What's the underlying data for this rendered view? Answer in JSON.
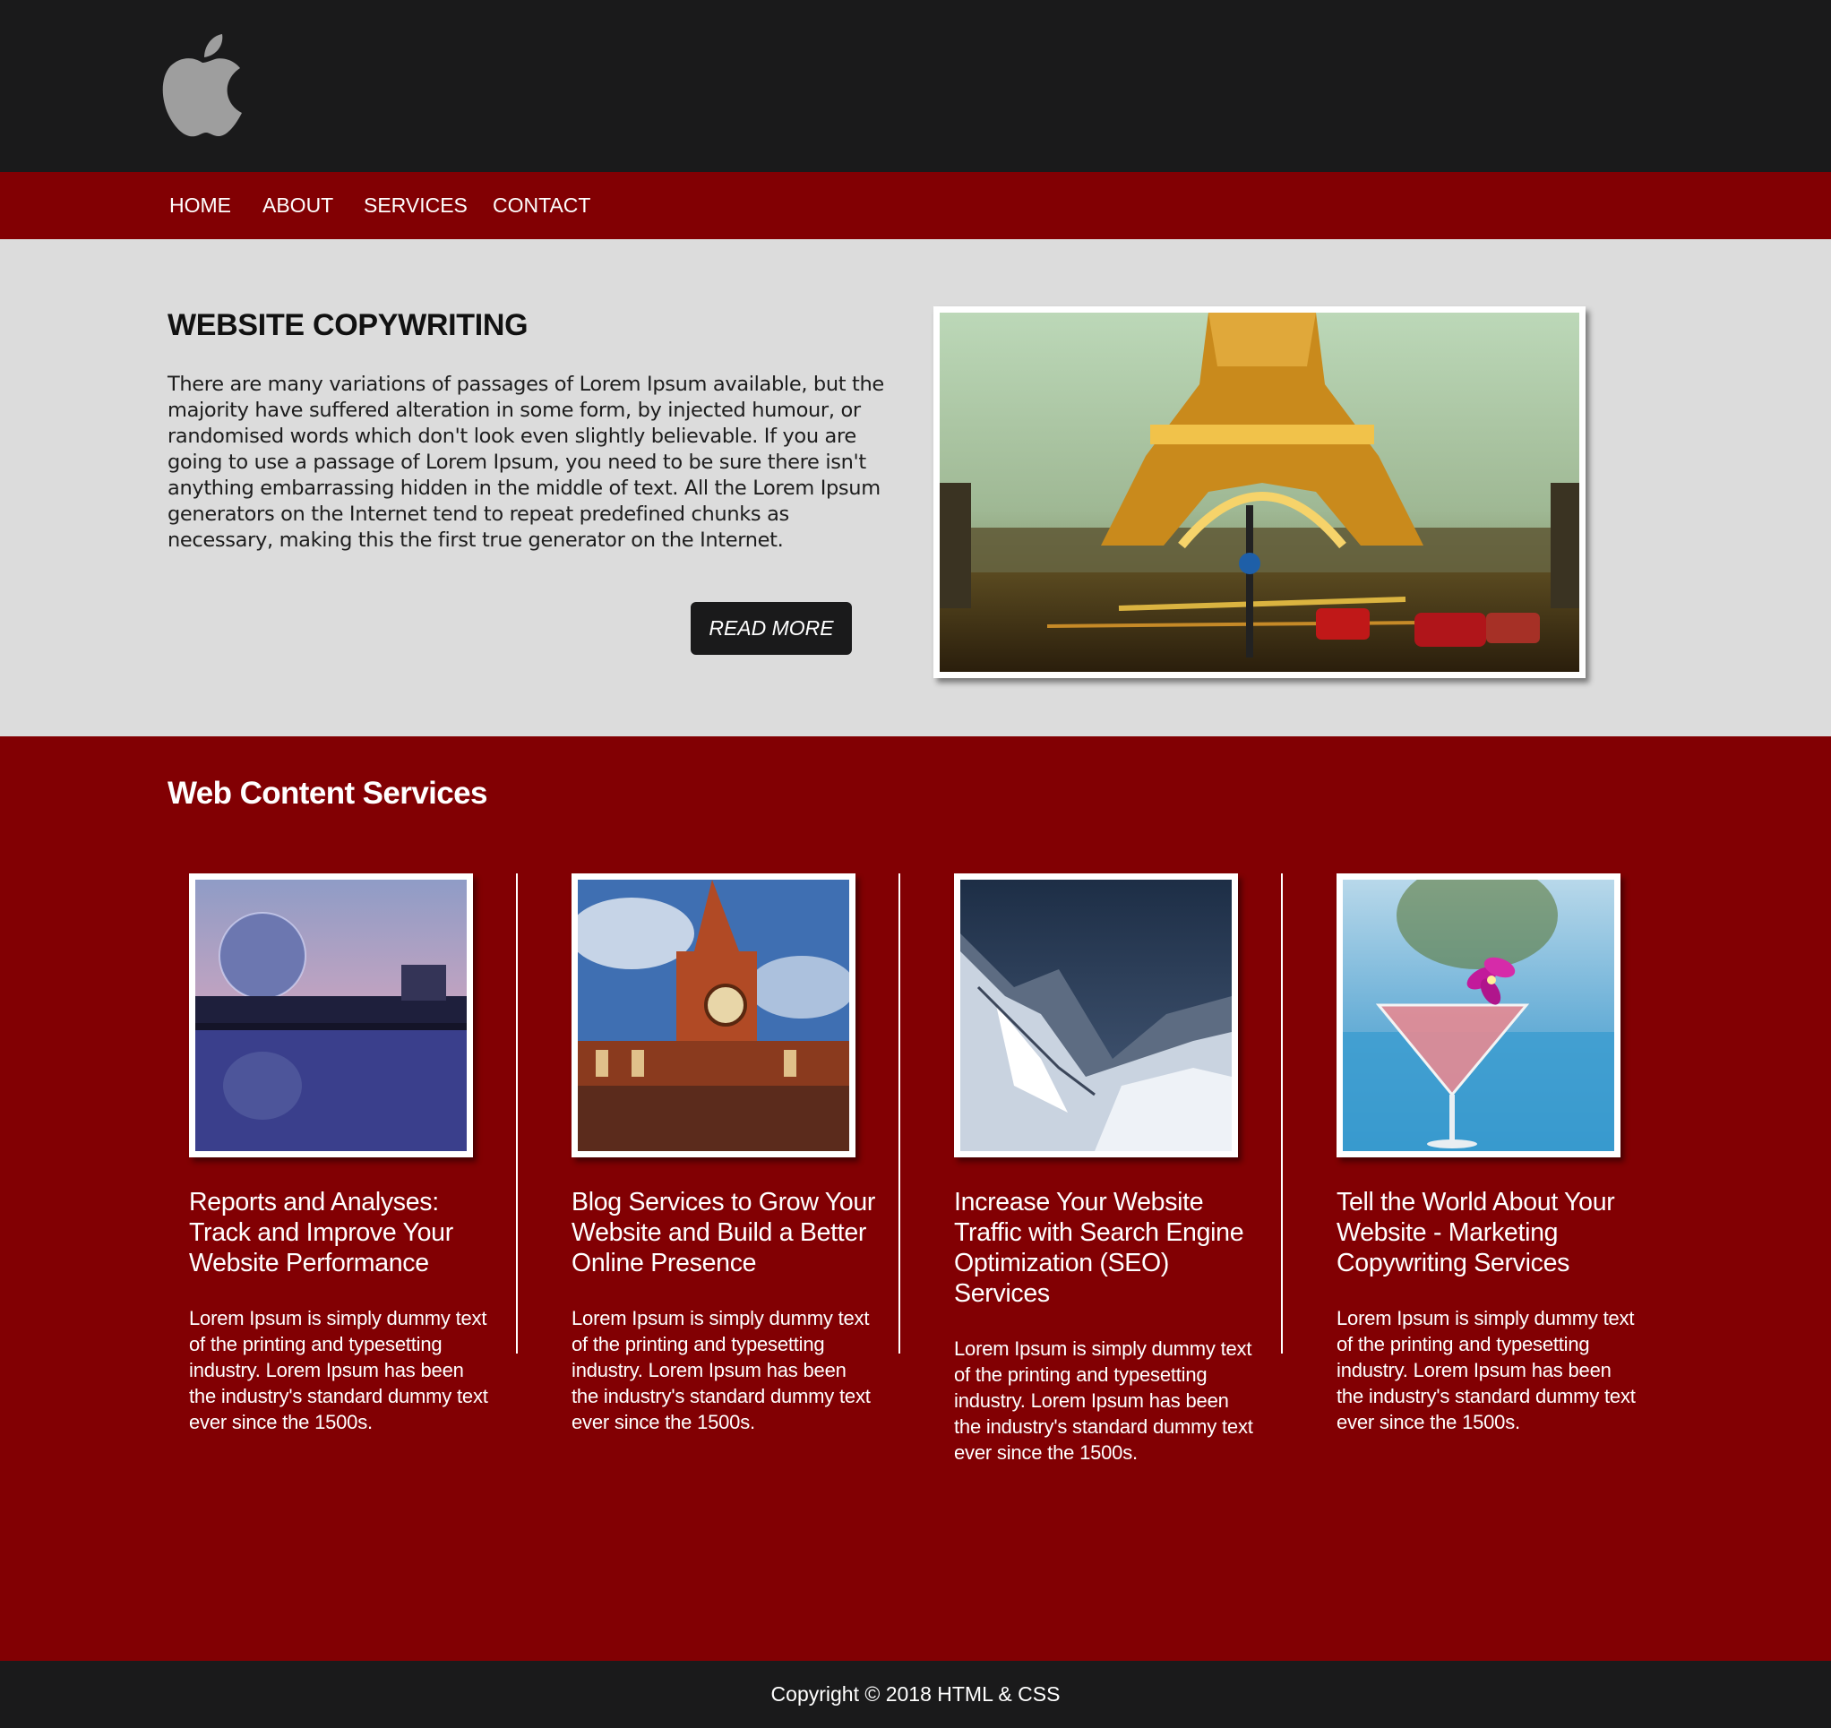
{
  "header": {
    "logo_icon": "apple-logo-icon",
    "nav": [
      {
        "label": "HOME"
      },
      {
        "label": "ABOUT"
      },
      {
        "label": "SERVICES"
      },
      {
        "label": "CONTACT"
      }
    ]
  },
  "hero": {
    "title": "WEBSITE COPYWRITING",
    "body": "There are many variations of passages of Lorem Ipsum available, but the majority have suffered alteration in some form, by injected humour, or randomised words which don't look even slightly believable. If you are going to use a passage of Lorem Ipsum, you need to be sure there isn't anything embarrassing hidden in the middle of text. All the Lorem Ipsum generators on the Internet tend to repeat predefined chunks as necessary, making this the first true generator on the Internet.",
    "button_label": "READ MORE",
    "image": "eiffel-tower-photo"
  },
  "services": {
    "title": "Web Content Services",
    "cards": [
      {
        "image": "science-dome-reflection-photo",
        "title": "Reports and Analyses: Track and Improve Your Website Performance",
        "text": "Lorem Ipsum is simply dummy text of the printing and typesetting industry. Lorem Ipsum has been the industry's standard dummy text ever since the 1500s."
      },
      {
        "image": "gothic-clock-tower-photo",
        "title": "Blog Services to Grow Your Website and Build a Better Online Presence",
        "text": "Lorem Ipsum is simply dummy text of the printing and typesetting industry. Lorem Ipsum has been the industry's standard dummy text ever since the 1500s."
      },
      {
        "image": "snowy-mountains-photo",
        "title": "Increase Your Website Traffic with Search Engine Optimization (SEO) Services",
        "text": "Lorem Ipsum is simply dummy text of the printing and typesetting industry. Lorem Ipsum has been the industry's standard dummy text ever since the 1500s."
      },
      {
        "image": "cocktail-with-orchid-photo",
        "title": "Tell the World About Your Website - Marketing Copywriting Services",
        "text": "Lorem Ipsum is simply dummy text of the printing and typesetting industry. Lorem Ipsum has been the industry's standard dummy text ever since the 1500s."
      }
    ]
  },
  "footer": {
    "copyright": "Copyright © 2018 HTML & CSS"
  },
  "colors": {
    "dark": "#1a1a1b",
    "brand_red": "#820003",
    "hero_bg": "#dcdcdc",
    "text_light": "#ffffff"
  }
}
